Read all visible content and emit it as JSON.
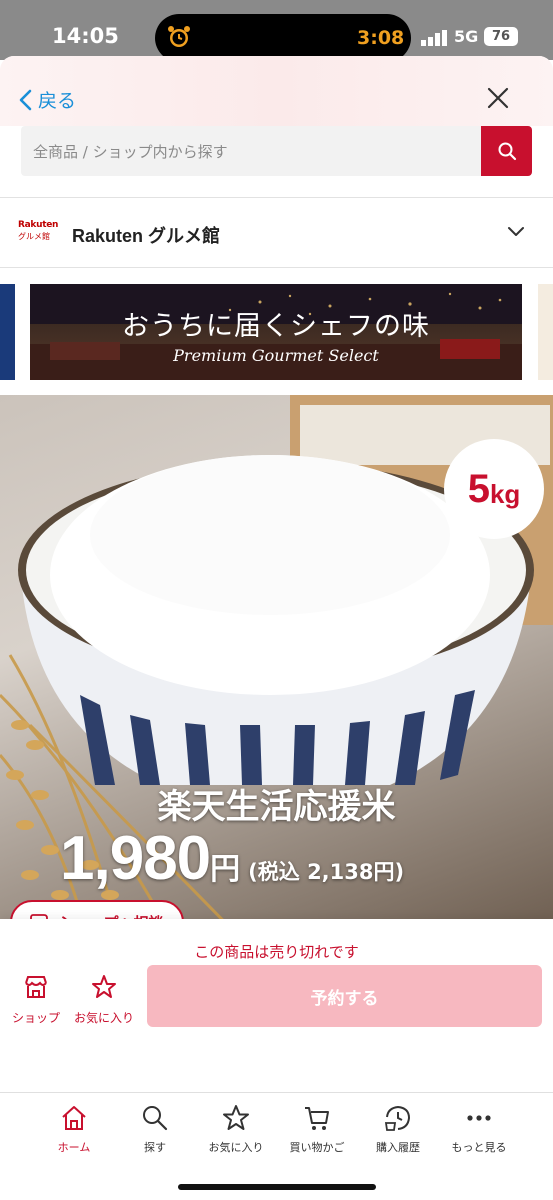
{
  "status_bar": {
    "time": "14:05",
    "timer": "3:08",
    "network": "5G",
    "battery": "76"
  },
  "nav": {
    "back_label": "戻る"
  },
  "search": {
    "placeholder": "全商品 / ショップ内から探す"
  },
  "shop": {
    "logo_line1": "Rakuten",
    "logo_line2": "グルメ館",
    "name": "Rakuten グルメ館"
  },
  "banner": {
    "title": "おうちに届くシェフの味",
    "subtitle": "Premium Gourmet Select"
  },
  "product": {
    "badge_num": "5",
    "badge_unit": "kg",
    "name": "楽天生活応援米",
    "price": "1,980",
    "price_unit": "円",
    "price_tax": "(税込 2,138円)"
  },
  "consult": {
    "label": "ショップへ相談"
  },
  "purchase": {
    "soldout_text": "この商品は売り切れです",
    "shop_label": "ショップ",
    "favorite_label": "お気に入り",
    "reserve_label": "予約する"
  },
  "tabbar": {
    "items": [
      {
        "label": "ホーム",
        "icon": "home-icon",
        "active": true
      },
      {
        "label": "探す",
        "icon": "search-icon",
        "active": false
      },
      {
        "label": "お気に入り",
        "icon": "star-icon",
        "active": false
      },
      {
        "label": "買い物かご",
        "icon": "cart-icon",
        "active": false
      },
      {
        "label": "購入履歴",
        "icon": "history-icon",
        "active": false
      },
      {
        "label": "もっと見る",
        "icon": "more-icon",
        "active": false
      }
    ]
  },
  "colors": {
    "brand": "#c8102e",
    "link": "#1a8fd8",
    "reserve_disabled": "#f7b8c0"
  }
}
